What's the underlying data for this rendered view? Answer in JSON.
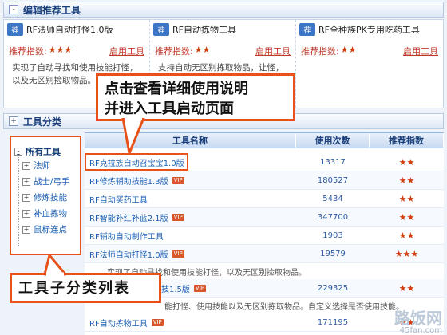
{
  "header": {
    "title": "编辑推荐工具"
  },
  "recommended": {
    "rating_label": "推荐指数:",
    "tools": [
      {
        "badge": "荐",
        "name": "RF法师自动打怪1.0版",
        "stars": "★★★",
        "action": "启用工具",
        "description": "实现了自动寻找和使用技能打怪，以及无区别捡取物品。"
      },
      {
        "badge": "荐",
        "name": "RF自动拣物工具",
        "stars": "★★",
        "action": "启用工具",
        "description": "支持自动无区别拣取物品，让怪，以及无区别捡取物品。"
      },
      {
        "badge": "荐",
        "name": "RF全种族PK专用吃药工具",
        "stars": "★★",
        "action": "启用工具",
        "description": ""
      }
    ]
  },
  "categories": {
    "title": "工具分类",
    "tree_root": "所有工具",
    "tree_items": [
      "法师",
      "战士/弓手",
      "修炼技能",
      "补血拣物",
      "鼠标连点"
    ]
  },
  "table": {
    "columns": [
      "工具名称",
      "使用次数",
      "推荐指数"
    ],
    "vip_label": "VIP",
    "rows": [
      {
        "name": "RF克拉族自动召宝宝1.0版",
        "vip": false,
        "count": "13317",
        "stars": "★★"
      },
      {
        "name": "RF修炼辅助技能1.3版",
        "vip": true,
        "count": "180527",
        "stars": "★★"
      },
      {
        "name": "RF自动买药工具",
        "vip": false,
        "count": "5434",
        "stars": "★★"
      },
      {
        "name": "RF智能补红补蓝2.1版",
        "vip": true,
        "count": "347700",
        "stars": "★★"
      },
      {
        "name": "RF辅助自动制作工具",
        "vip": false,
        "count": "1903",
        "stars": "★★"
      },
      {
        "name": "RF法师自动打怪1.0版",
        "vip": true,
        "count": "19579",
        "stars": "★★★"
      },
      {
        "name": "技1.5版",
        "vip": true,
        "count": "229325",
        "stars": "★★"
      },
      {
        "name": "RF自动拣物工具",
        "vip": true,
        "count": "171195",
        "stars": "★★"
      }
    ],
    "details": [
      "实现了自动寻找和使用技能打怪，以及无区别捡取物品。",
      "能打怪、使用技能以及无区别拣取物品。自定义选择是否使用技能。"
    ]
  },
  "callouts": {
    "main_line1": "点击查看详细使用说明",
    "main_line2": "并进入工具启动页面",
    "sub": "工具子分类列表"
  },
  "watermark": {
    "main": "路饭网",
    "sub": "45fan.com"
  },
  "colors": {
    "accent": "#e8521a",
    "link": "#1a5fb4",
    "header_text": "#1a3f7a"
  }
}
